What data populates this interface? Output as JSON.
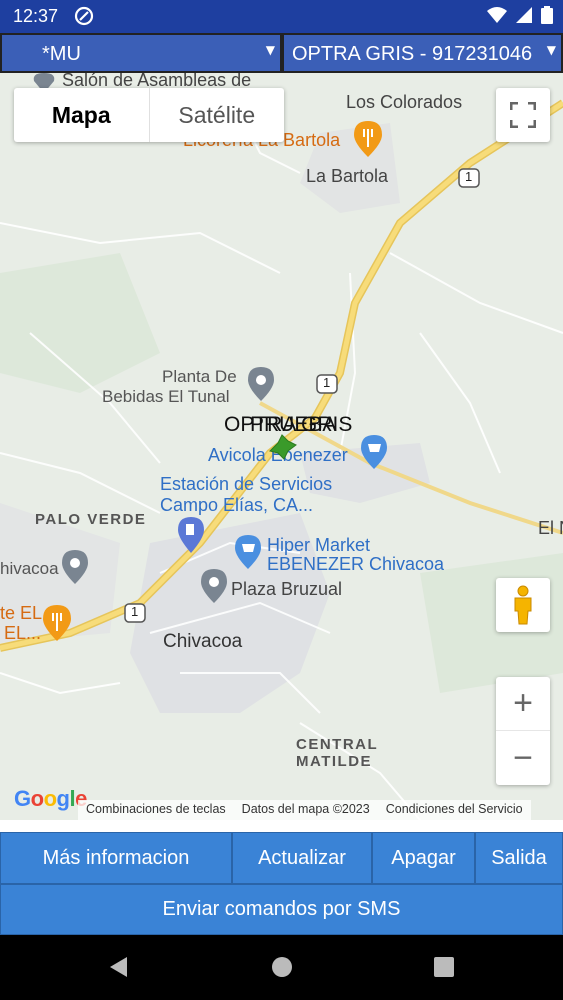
{
  "status_bar": {
    "time": "12:37",
    "icons": [
      "app-notification-icon",
      "wifi-icon",
      "signal-icon",
      "battery-icon"
    ]
  },
  "selectors": {
    "group": {
      "value": "*MU"
    },
    "vehicle": {
      "value": "OPTRA GRIS - 917231046"
    }
  },
  "map": {
    "map_types": {
      "map": "Mapa",
      "satellite": "Satélite"
    },
    "labels": {
      "salon": "Salón de Asambleas de",
      "los_colorados": "Los Colorados",
      "licoreria": "Licorería La Bartola",
      "la_bartola": "La Bartola",
      "planta_1": "Planta De",
      "planta_2": "Bebidas El Tunal",
      "avicola": "Avicola Ebenezer",
      "estacion_1": "Estación de Servicios",
      "estacion_2": "Campo Elías, CA...",
      "palo_verde": "PALO VERDE",
      "hiper_1": "Hiper Market",
      "hiper_2": "EBENEZER Chivacoa",
      "chivacoa_left": "hivacoa",
      "plaza": "Plaza Bruzual",
      "rest_1": "te EL",
      "rest_2": "EL...",
      "chivacoa": "Chivacoa",
      "central_1": "CENTRAL",
      "central_2": "MATILDE",
      "el_right": "El N",
      "road_1": "1"
    },
    "vehicle_marker_labels": [
      "OPTRA GRIS",
      "PRUEBA"
    ],
    "google": "Google",
    "footer": {
      "shortcuts": "Combinaciones de teclas",
      "data": "Datos del mapa ©2023",
      "terms": "Condiciones del Servicio"
    },
    "zoom_in": "+",
    "zoom_out": "−",
    "colors": {
      "background": "#e8ede6",
      "highway": "#f5d66a",
      "road": "#ffffff",
      "urban": "#dfe1e4",
      "marker": "#3a9a2a"
    }
  },
  "actions": {
    "more_info": "Más informacion",
    "update": "Actualizar",
    "turn_off": "Apagar",
    "exit": "Salida",
    "sms": "Enviar comandos por SMS"
  },
  "colors": {
    "status_bar": "#1e3fa0",
    "dropdown": "#3b5fb7",
    "button": "#3a83d6"
  }
}
